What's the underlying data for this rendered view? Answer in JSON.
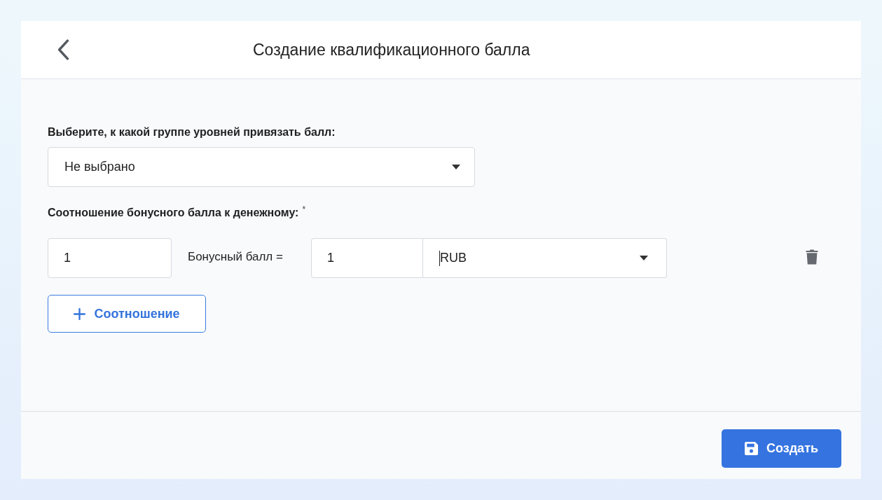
{
  "header": {
    "title": "Создание квалификационного балла"
  },
  "group_field": {
    "label": "Выберите, к какой группе уровней привязать балл:",
    "value": "Не выбрано"
  },
  "ratio_section": {
    "label": "Соотношение бонусного балла к денежному:",
    "required_mark": "*",
    "rows": [
      {
        "bonus_value": "1",
        "equals_text": "Бонусный балл =",
        "money_value": "1",
        "currency": "RUB",
        "currency_focused": true
      }
    ],
    "add_button": {
      "label": "Соотношение"
    }
  },
  "footer": {
    "submit_button": {
      "label": "Создать"
    }
  }
}
